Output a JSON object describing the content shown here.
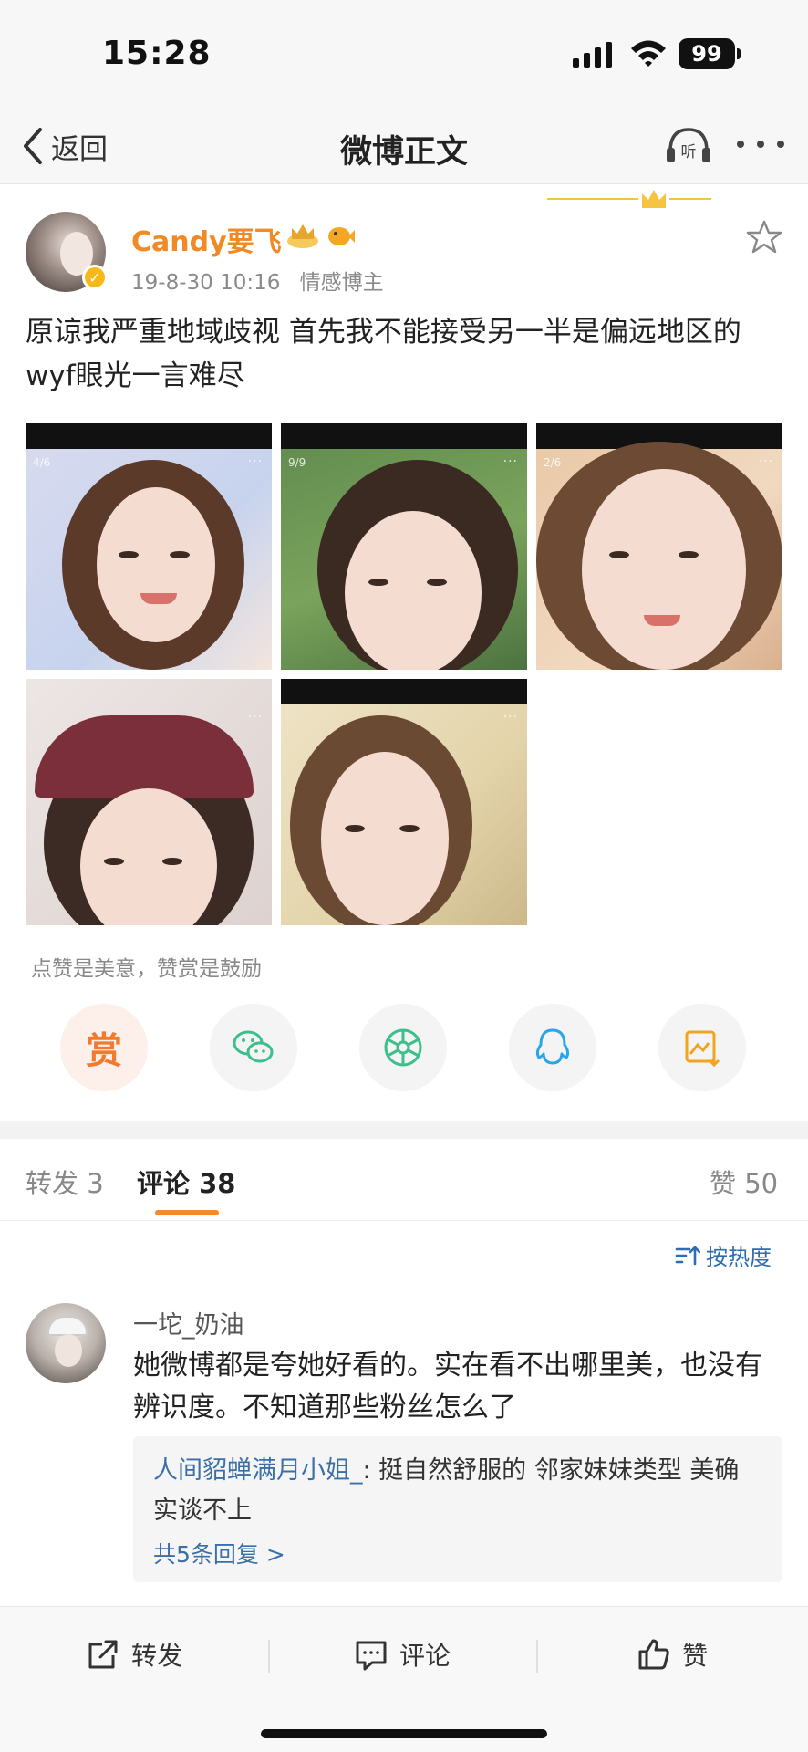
{
  "status": {
    "time": "15:28",
    "battery": "99"
  },
  "nav": {
    "back_label": "返回",
    "title": "微博正文"
  },
  "post": {
    "username": "Candy要飞",
    "date": "19-8-30 10:16",
    "tag": "情感博主",
    "text": "原谅我严重地域歧视 首先我不能接受另一半是偏远地区的 wyf眼光一言难尽",
    "images": [
      {
        "counter": "4/6"
      },
      {
        "counter": "9/9"
      },
      {
        "counter": "2/6"
      },
      {
        "counter": ""
      },
      {
        "counter": ""
      }
    ],
    "encourage_text": "点赞是美意，赞赏是鼓励",
    "reward_label": "赏"
  },
  "tabs": {
    "repost": "转发 3",
    "comments": "评论 38",
    "likes": "赞 50"
  },
  "sort_label": "按热度",
  "comment": {
    "author": "一坨_奶油",
    "text": "她微博都是夸她好看的。实在看不出哪里美，也没有辨识度。不知道那些粉丝怎么了",
    "reply": {
      "author": "人间貂蝉满月小姐_",
      "text": ": 挺自然舒服的 邻家妹妹类型 美确实谈不上",
      "more": "共5条回复 >"
    }
  },
  "actions": {
    "repost": "转发",
    "comment": "评论",
    "like": "赞"
  },
  "colors": {
    "accent_orange": "#f58a2a",
    "link_blue": "#3a6fa8",
    "username_orange": "#f08a24"
  }
}
